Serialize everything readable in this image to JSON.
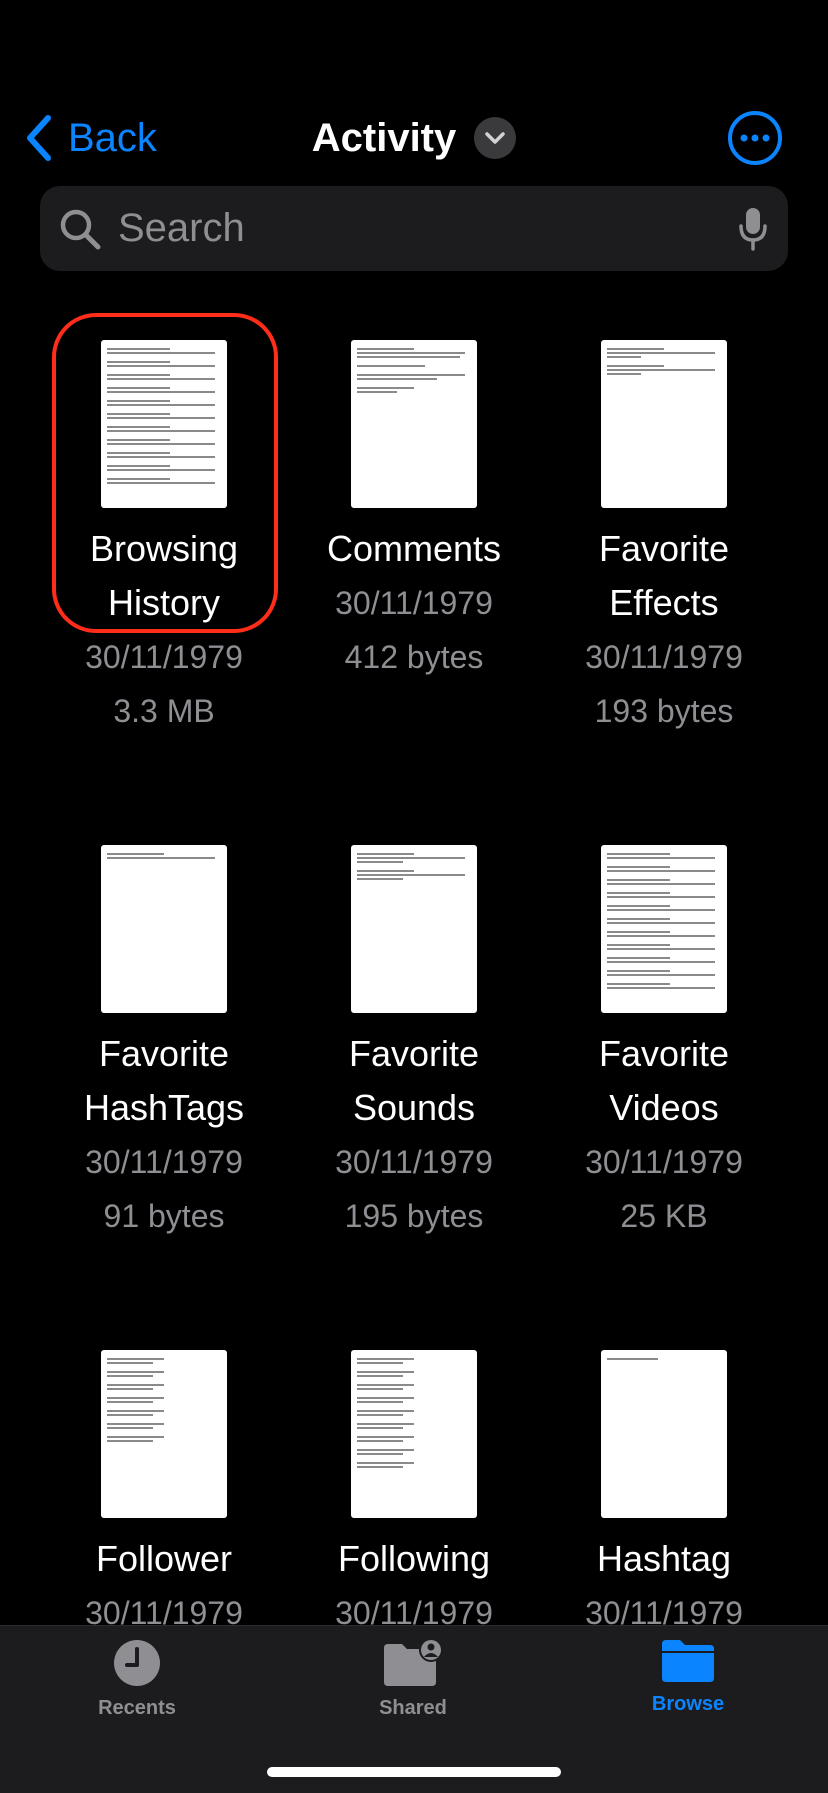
{
  "nav": {
    "back_label": "Back",
    "title": "Activity",
    "accent_color": "#0a84ff"
  },
  "search": {
    "placeholder": "Search"
  },
  "files": [
    {
      "name_line1": "Browsing",
      "name_line2": "History",
      "date": "30/11/1979",
      "size": "3.3 MB",
      "highlighted": true
    },
    {
      "name_line1": "Comments",
      "name_line2": "",
      "date": "30/11/1979",
      "size": "412 bytes"
    },
    {
      "name_line1": "Favorite",
      "name_line2": "Effects",
      "date": "30/11/1979",
      "size": "193 bytes"
    },
    {
      "name_line1": "Favorite",
      "name_line2": "HashTags",
      "date": "30/11/1979",
      "size": "91 bytes"
    },
    {
      "name_line1": "Favorite",
      "name_line2": "Sounds",
      "date": "30/11/1979",
      "size": "195 bytes"
    },
    {
      "name_line1": "Favorite",
      "name_line2": "Videos",
      "date": "30/11/1979",
      "size": "25 KB"
    },
    {
      "name_line1": "Follower",
      "name_line2": "",
      "date": "30/11/1979",
      "size": ""
    },
    {
      "name_line1": "Following",
      "name_line2": "",
      "date": "30/11/1979",
      "size": ""
    },
    {
      "name_line1": "Hashtag",
      "name_line2": "",
      "date": "30/11/1979",
      "size": ""
    }
  ],
  "tabs": [
    {
      "label": "Recents",
      "icon": "clock-icon",
      "active": false
    },
    {
      "label": "Shared",
      "icon": "shared-folder-icon",
      "active": false
    },
    {
      "label": "Browse",
      "icon": "folder-icon",
      "active": true
    }
  ],
  "colors": {
    "active_tab": "#0a84ff",
    "inactive_tab": "#8e8e93",
    "highlight_ring": "#ff2d1a"
  }
}
